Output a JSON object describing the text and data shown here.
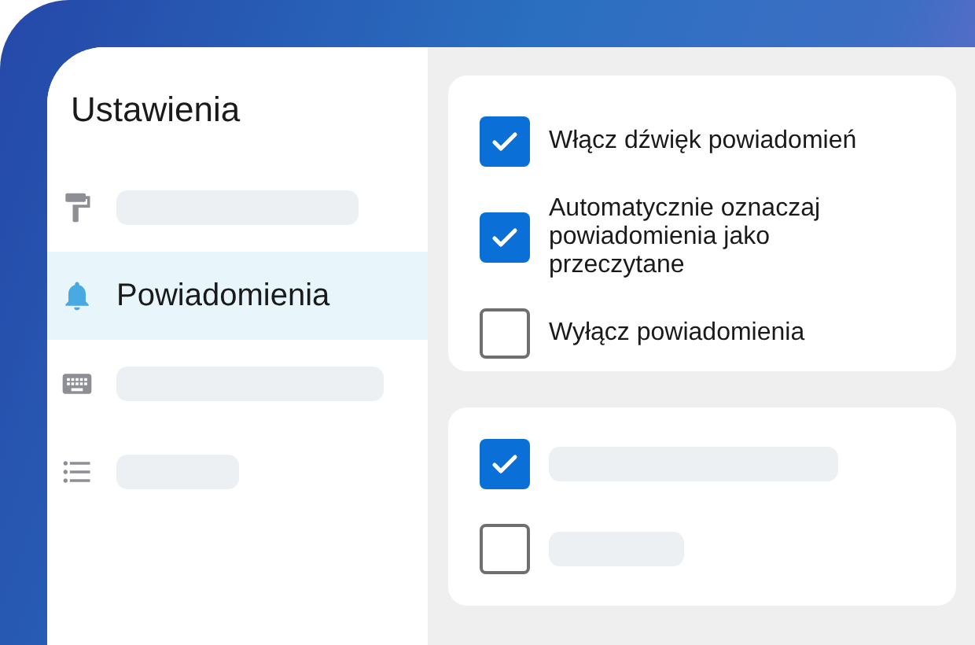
{
  "sidebar": {
    "title": "Ustawienia",
    "items": [
      {
        "selected": false
      },
      {
        "label": "Powiadomienia",
        "selected": true
      },
      {
        "selected": false
      },
      {
        "selected": false
      }
    ]
  },
  "cards": [
    {
      "options": [
        {
          "label": "Włącz dźwięk powiadomień",
          "checked": true
        },
        {
          "label": "Automatycznie oznaczaj powiadomienia jako przeczytane",
          "checked": true
        },
        {
          "label": "Wyłącz powiadomienia",
          "checked": false
        }
      ]
    },
    {
      "options": [
        {
          "checked": true
        },
        {
          "checked": false
        }
      ]
    }
  ]
}
